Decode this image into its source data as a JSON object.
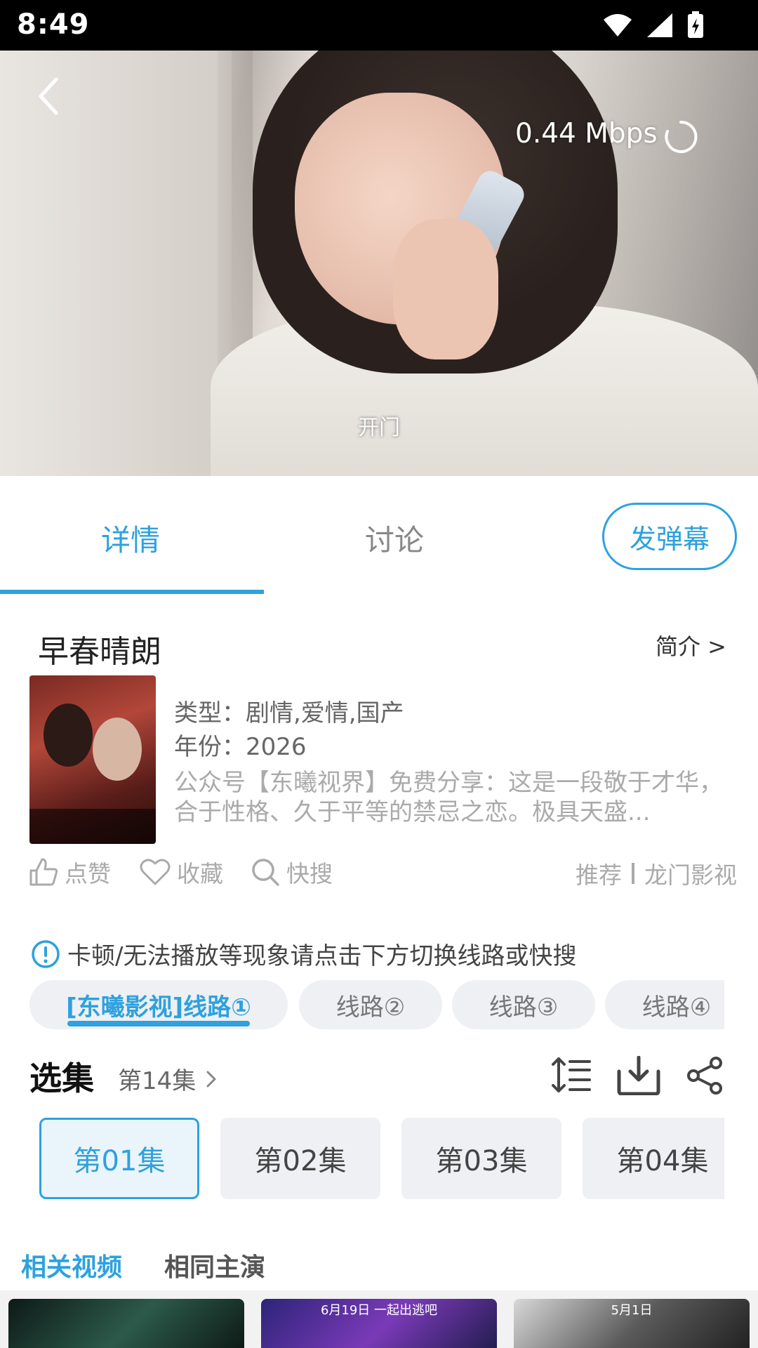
{
  "status_bar": {
    "time": "8:49"
  },
  "player": {
    "speed": "0.44 Mbps",
    "subtitle": "开门"
  },
  "tabs": {
    "details": "详情",
    "discussion": "讨论",
    "danmu_button": "发弹幕"
  },
  "show": {
    "title": "早春晴朗",
    "intro_link": "简介 >",
    "type": "类型：剧情,爱情,国产",
    "year": "年份：2026",
    "description": "公众号【东曦视界】免费分享：这是一段敬于才华，合于性格、久于平等的禁忌之恋。极具天盛..."
  },
  "actions": {
    "like": "点赞",
    "favorite": "收藏",
    "quick_search": "快搜",
    "recommend": "推荐",
    "source": "龙门影视"
  },
  "notice": "卡顿/无法播放等现象请点击下方切换线路或快搜",
  "routes": [
    "[东曦影视]线路①",
    "线路②",
    "线路③",
    "线路④"
  ],
  "episodes_section": {
    "title": "选集",
    "current": "第14集",
    "items": [
      "第01集",
      "第02集",
      "第03集",
      "第04集"
    ]
  },
  "related": {
    "tabs": [
      "相关视频",
      "相同主演"
    ],
    "thumb_captions": [
      "",
      "6月19日 一起出逃吧",
      "5月1日"
    ]
  },
  "colors": {
    "accent": "#2ea1de",
    "chip_bg": "#eef0f3"
  }
}
